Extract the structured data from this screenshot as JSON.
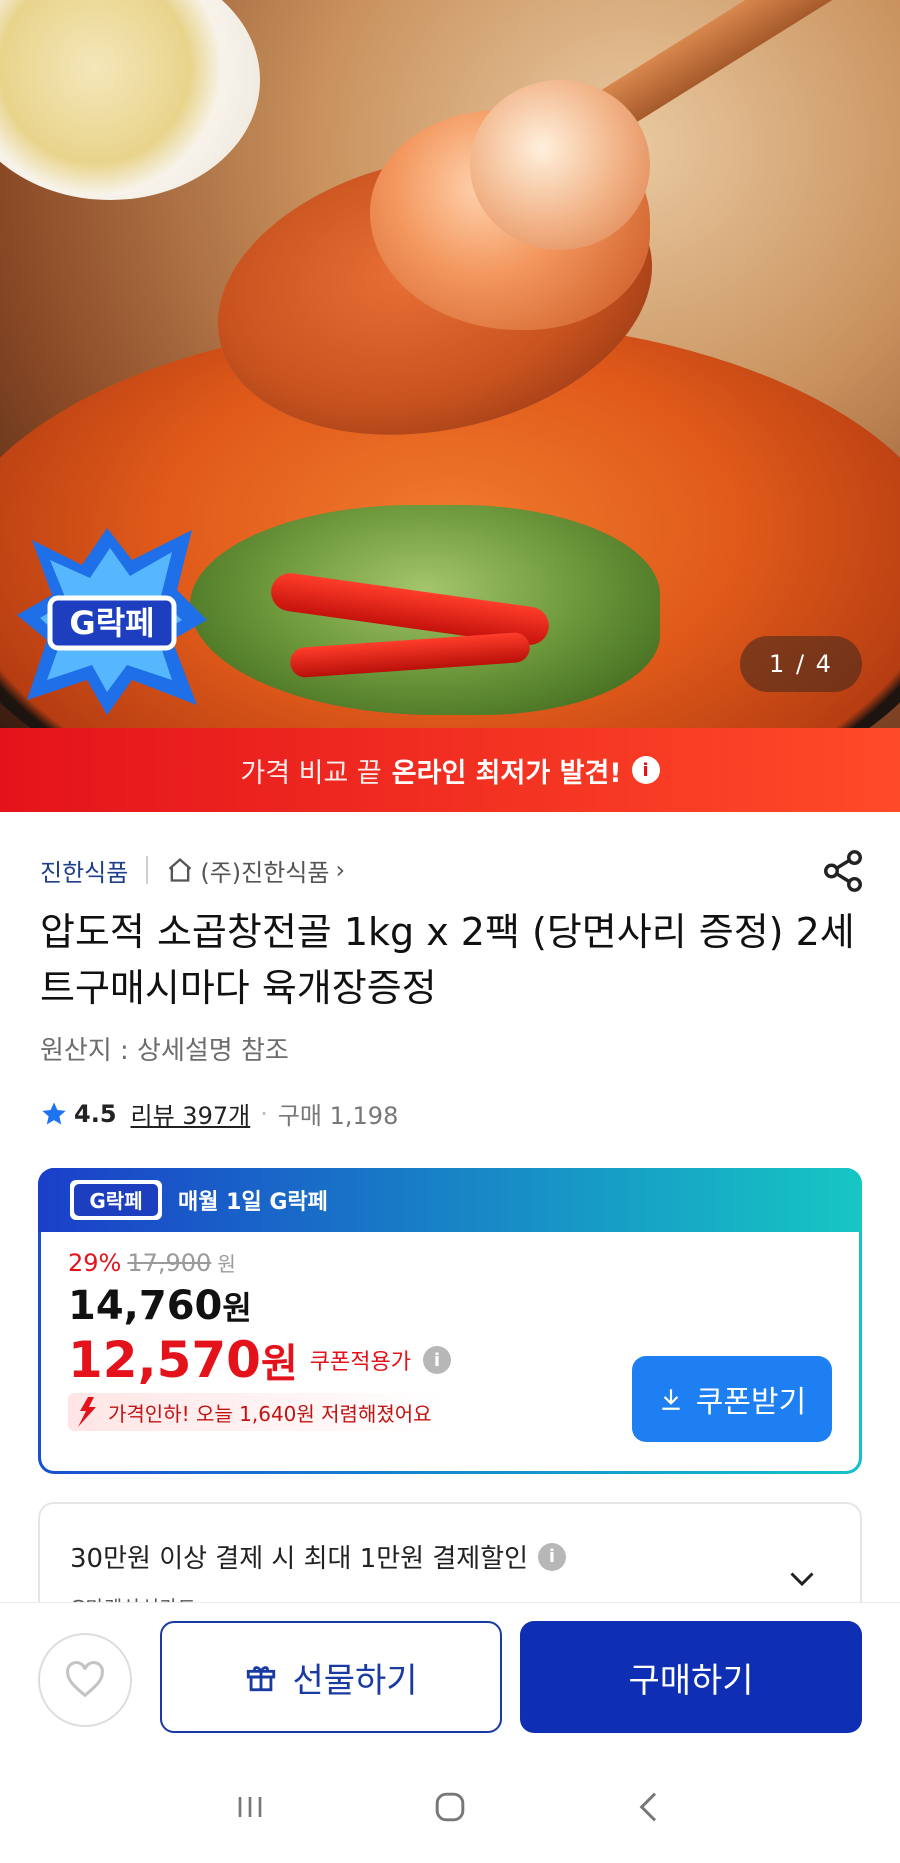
{
  "hero": {
    "counter": "1 / 4",
    "badge_text": "G락페"
  },
  "promo": {
    "light": "가격 비교 끝",
    "bold": "온라인 최저가 발견!",
    "info_glyph": "i"
  },
  "seller": {
    "brand": "진한식품",
    "shop": "(주)진한식품",
    "chevron": "›"
  },
  "product": {
    "title": "압도적 소곱창전골 1kg x 2팩 (당면사리 증정) 2세트구매시마다 육개장증정",
    "origin": "원산지 : 상세설명 참조",
    "rating": "4.5",
    "review": "리뷰 397개",
    "dot": "·",
    "purchases": "구매 1,198"
  },
  "coupon": {
    "head_text": "매월 1일 G락페",
    "discount_pct": "29%",
    "original_price": "17,900",
    "original_won": "원",
    "price": "14,760",
    "price_won": "원",
    "coupon_price": "12,570",
    "coupon_won": "원",
    "coupon_applied": "쿠폰적용가",
    "info_glyph": "i",
    "drop_note": "가격인하! 오늘 1,640원 저렴해졌어요",
    "button": "쿠폰받기"
  },
  "payment": {
    "line1": "30만원 이상 결제 시 최대 1만원 결제할인",
    "line2": "G마켓삼성카드",
    "info_glyph": "i"
  },
  "actions": {
    "gift": "선물하기",
    "buy": "구매하기"
  },
  "colors": {
    "brand_red": "#e4131b",
    "brand_blue": "#0e2fb3",
    "coupon_blue": "#1d7ff2"
  }
}
